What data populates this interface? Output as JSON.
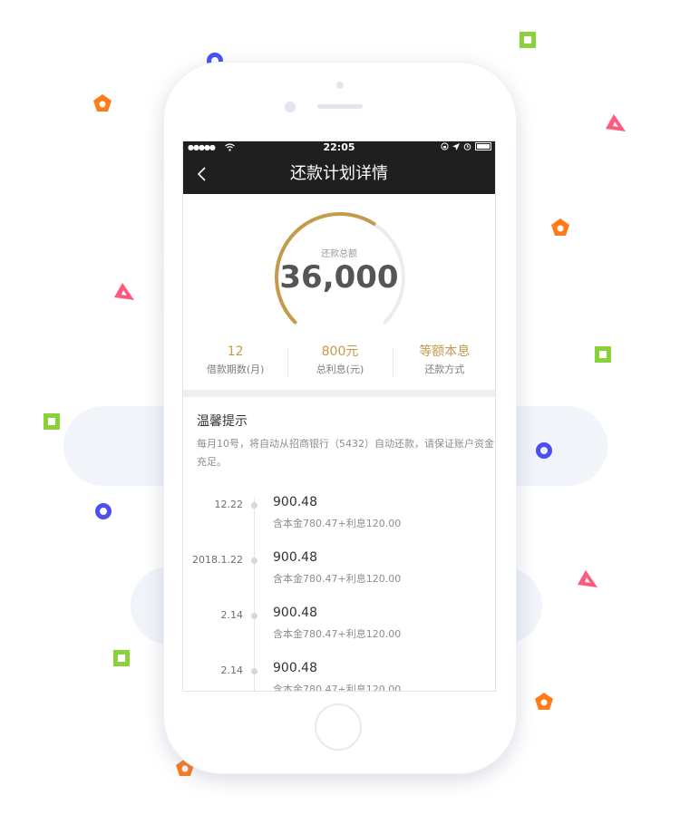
{
  "status_bar": {
    "signal": "●●●●●",
    "wifi": "wifi-icon",
    "time": "22:05",
    "icons": [
      "lock-rotation-icon",
      "location-icon",
      "alarm-icon",
      "battery-icon"
    ]
  },
  "nav": {
    "back_icon": "chevron-left-icon",
    "title": "还款计划详情"
  },
  "summary": {
    "total_label": "还款总额",
    "total_value": "36,000",
    "progress_fraction": 0.62
  },
  "stats": [
    {
      "value": "12",
      "label": "借款期数(月)"
    },
    {
      "value": "800元",
      "label": "总利息(元)"
    },
    {
      "value": "等额本息",
      "label": "还款方式"
    }
  ],
  "tip": {
    "title": "温馨提示",
    "text": "每月10号，将自动从招商银行（5432）自动还款，请保证账户资金充足。"
  },
  "schedule": [
    {
      "date": "12.22",
      "amount": "900.48",
      "detail": "含本金780.47+利息120.00"
    },
    {
      "date": "2018.1.22",
      "amount": "900.48",
      "detail": "含本金780.47+利息120.00"
    },
    {
      "date": "2.14",
      "amount": "900.48",
      "detail": "含本金780.47+利息120.00"
    },
    {
      "date": "2.14",
      "amount": "900.48",
      "detail": "含本金780.47+利息120.00"
    }
  ],
  "colors": {
    "accent_gold": "#c49a4b",
    "nav_bg": "#1f1f1f",
    "gauge_track": "#ececec"
  }
}
